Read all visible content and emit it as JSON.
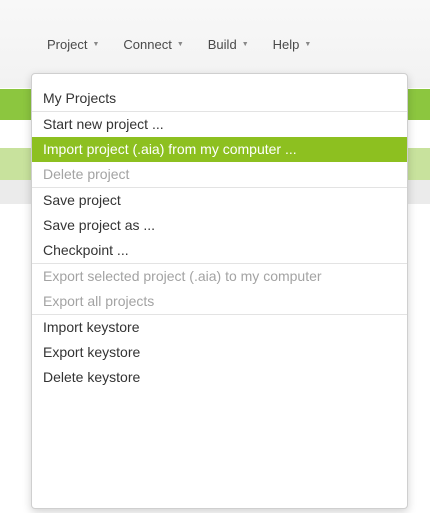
{
  "menubar": {
    "items": [
      {
        "label": "Project",
        "caret": "▼"
      },
      {
        "label": "Connect",
        "caret": "▼"
      },
      {
        "label": "Build",
        "caret": "▼"
      },
      {
        "label": "Help",
        "caret": "▼"
      }
    ]
  },
  "dropdown": {
    "groups": [
      [
        {
          "label": "My Projects",
          "state": "enabled"
        }
      ],
      [
        {
          "label": "Start new project ...",
          "state": "enabled"
        },
        {
          "label": "Import project (.aia) from my computer ...",
          "state": "highlighted"
        },
        {
          "label": "Delete project",
          "state": "disabled"
        }
      ],
      [
        {
          "label": "Save project",
          "state": "enabled"
        },
        {
          "label": "Save project as ...",
          "state": "enabled"
        },
        {
          "label": "Checkpoint ...",
          "state": "enabled"
        }
      ],
      [
        {
          "label": "Export selected project (.aia) to my computer",
          "state": "disabled"
        },
        {
          "label": "Export all projects",
          "state": "disabled"
        }
      ],
      [
        {
          "label": "Import keystore",
          "state": "enabled"
        },
        {
          "label": "Export keystore",
          "state": "enabled"
        },
        {
          "label": "Delete keystore",
          "state": "enabled"
        }
      ]
    ]
  },
  "colors": {
    "highlight": "#8dc020",
    "header_green": "#8cc63f",
    "disabled_text": "#a3a3a3"
  }
}
